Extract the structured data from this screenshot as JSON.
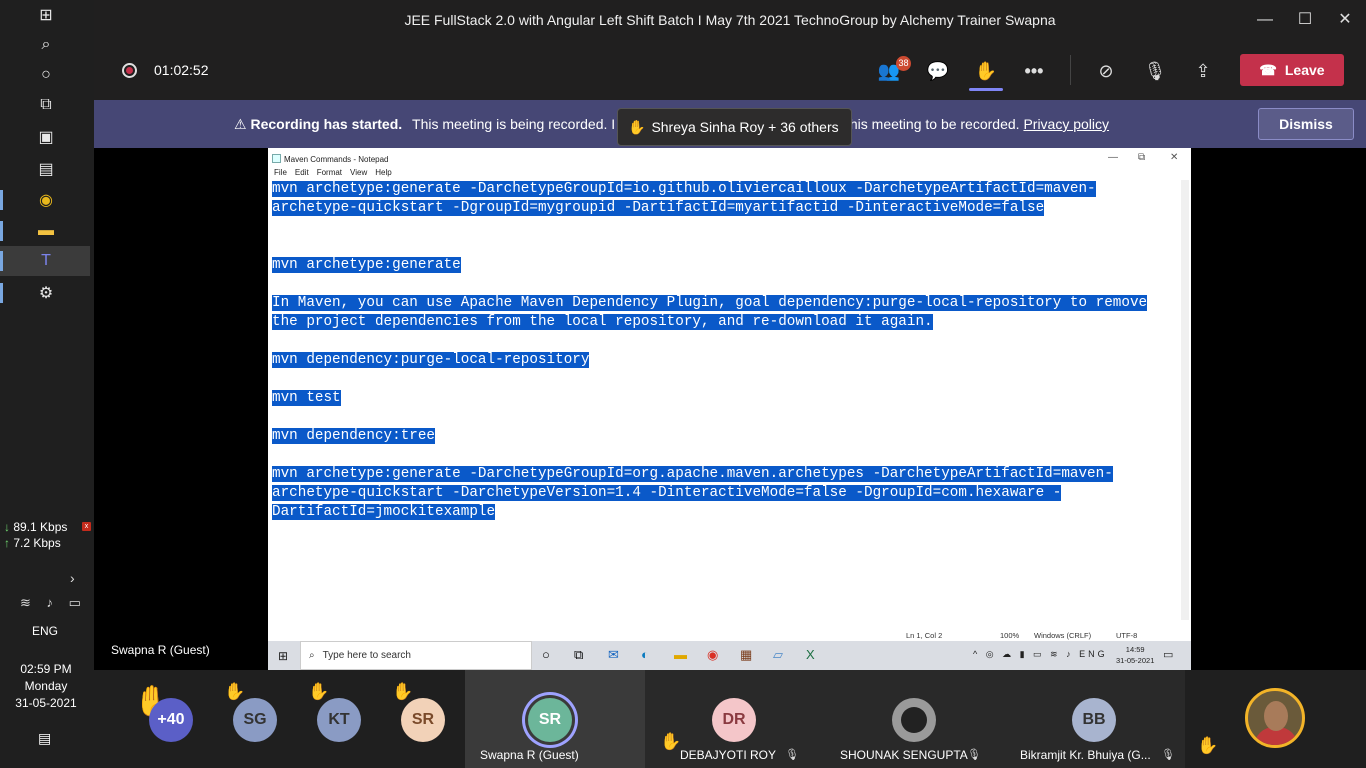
{
  "left_taskbar": {
    "net_down": "89.1 Kbps",
    "net_up": "7.2 Kbps",
    "language": "ENG",
    "time": "02:59 PM",
    "day": "Monday",
    "date": "31-05-2021"
  },
  "window": {
    "title": "JEE FullStack 2.0 with Angular Left Shift Batch I May 7th 2021 TechnoGroup by Alchemy Trainer Swapna"
  },
  "meeting_bar": {
    "timer": "01:02:52",
    "participants_count": "38",
    "leave_label": "Leave"
  },
  "banner": {
    "heading": "Recording has started.",
    "text": "This meeting is being recorded. I",
    "text_after": "this meeting to be recorded.",
    "link": "Privacy policy",
    "dismiss_label": "Dismiss",
    "toast": "Shreya Sinha Roy + 36 others"
  },
  "notepad": {
    "title": "Maven Commands - Notepad",
    "menu": [
      "File",
      "Edit",
      "Format",
      "View",
      "Help"
    ],
    "lines": [
      {
        "t": "mvn archetype:generate -DarchetypeGroupId=io.github.oliviercailloux -DarchetypeArtifactId=maven-",
        "s": true
      },
      {
        "t": "archetype-quickstart -DgroupId=mygroupid -DartifactId=myartifactid -DinteractiveMode=false",
        "s": true
      },
      {
        "t": "",
        "s": false
      },
      {
        "t": "",
        "s": false
      },
      {
        "t": "mvn archetype:generate",
        "s": true
      },
      {
        "t": "",
        "s": false
      },
      {
        "t": "In Maven, you can use Apache Maven Dependency Plugin, goal dependency:purge-local-repository to remove",
        "s": true
      },
      {
        "t": "the project dependencies from the local repository, and re-download it again.",
        "s": true
      },
      {
        "t": "",
        "s": false
      },
      {
        "t": "mvn dependency:purge-local-repository",
        "s": true
      },
      {
        "t": "",
        "s": false
      },
      {
        "t": "mvn test",
        "s": true
      },
      {
        "t": "",
        "s": false
      },
      {
        "t": "mvn dependency:tree",
        "s": true
      },
      {
        "t": "",
        "s": false
      },
      {
        "t": "mvn archetype:generate -DarchetypeGroupId=org.apache.maven.archetypes -DarchetypeArtifactId=maven-",
        "s": true
      },
      {
        "t": "archetype-quickstart -DarchetypeVersion=1.4 -DinteractiveMode=false -DgroupId=com.hexaware -",
        "s": true
      },
      {
        "t": "DartifactId=jmockitexample",
        "s": true
      }
    ],
    "status": {
      "position": "Ln 1, Col 2",
      "zoom": "100%",
      "line_endings": "Windows (CRLF)",
      "encoding": "UTF-8"
    }
  },
  "shared_taskbar": {
    "search_placeholder": "Type here to search",
    "tray_lang": "ENG",
    "time": "14:59",
    "date": "31-05-2021"
  },
  "presenter": "Swapna R (Guest)",
  "participants": {
    "overflow": "+40",
    "avatars": [
      {
        "initials": "SG",
        "color": "#8a9bc4"
      },
      {
        "initials": "KT",
        "color": "#8a9bc4"
      },
      {
        "initials": "SR",
        "color": "#f2d2b8"
      }
    ],
    "tiles": [
      {
        "initials": "SR",
        "name": "Swapna R (Guest)"
      },
      {
        "initials": "DR",
        "name": "DEBAJYOTI ROY"
      },
      {
        "initials": "",
        "name": "SHOUNAK SENGUPTA"
      },
      {
        "initials": "BB",
        "name": "Bikramjit Kr. Bhuiya (G..."
      }
    ]
  },
  "colors": {
    "banner_bg": "#464775",
    "leave_red": "#c4314b",
    "selection_blue": "#0a59c9",
    "accent_purple": "#7f85f5"
  }
}
